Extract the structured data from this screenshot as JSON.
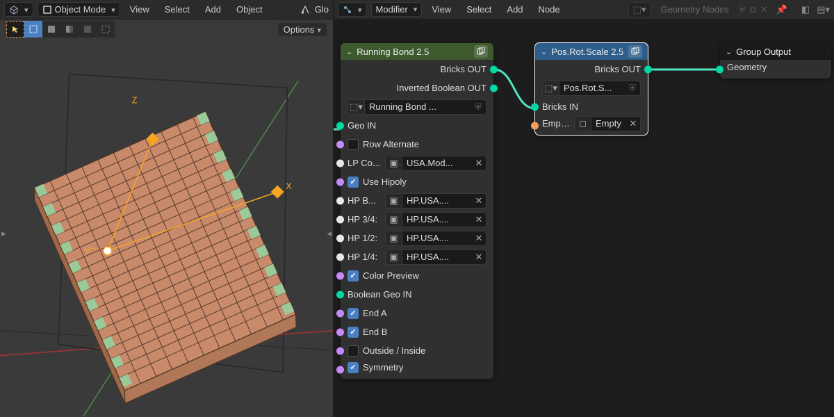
{
  "left": {
    "header": {
      "mode": "Object Mode",
      "menus": [
        "View",
        "Select",
        "Add",
        "Object"
      ],
      "global": "Glo"
    },
    "options": "Options",
    "gizmo": {
      "x": "X",
      "y": "Y",
      "z": "Z"
    }
  },
  "right": {
    "header": {
      "mode": "Modifier",
      "menus": [
        "View",
        "Select",
        "Add",
        "Node"
      ],
      "workspace": "Geometry Nodes"
    },
    "nodes": {
      "running_bond": {
        "title": "Running Bond 2.5",
        "out1": "Bricks OUT",
        "out2": "Inverted Boolean OUT",
        "group_field": "Running Bond ...",
        "geo_in": "Geo IN",
        "row_alternate": "Row Alternate",
        "lp_label": "LP Co...",
        "lp_val": "USA.Mod...",
        "use_hipoly": "Use Hipoly",
        "hp_b_label": "HP B...",
        "hp_b_val": "HP.USA....",
        "hp_34_label": "HP 3/4:",
        "hp_34_val": "HP.USA....",
        "hp_12_label": "HP 1/2:",
        "hp_12_val": "HP.USA....",
        "hp_14_label": "HP 1/4:",
        "hp_14_val": "HP.USA....",
        "color_preview": "Color Preview",
        "boolean_geo_in": "Boolean Geo IN",
        "end_a": "End A",
        "end_b": "End B",
        "outside_inside": "Outside / Inside",
        "symmetry": "Symmetry"
      },
      "pos_rot_scale": {
        "title": "Pos.Rot.Scale 2.5",
        "out": "Bricks OUT",
        "group_field": "Pos.Rot.S...",
        "bricks_in": "Bricks IN",
        "empty_label": "Empt...",
        "empty_val": "Empty"
      },
      "group_output": {
        "title": "Group Output",
        "geometry": "Geometry"
      }
    }
  }
}
